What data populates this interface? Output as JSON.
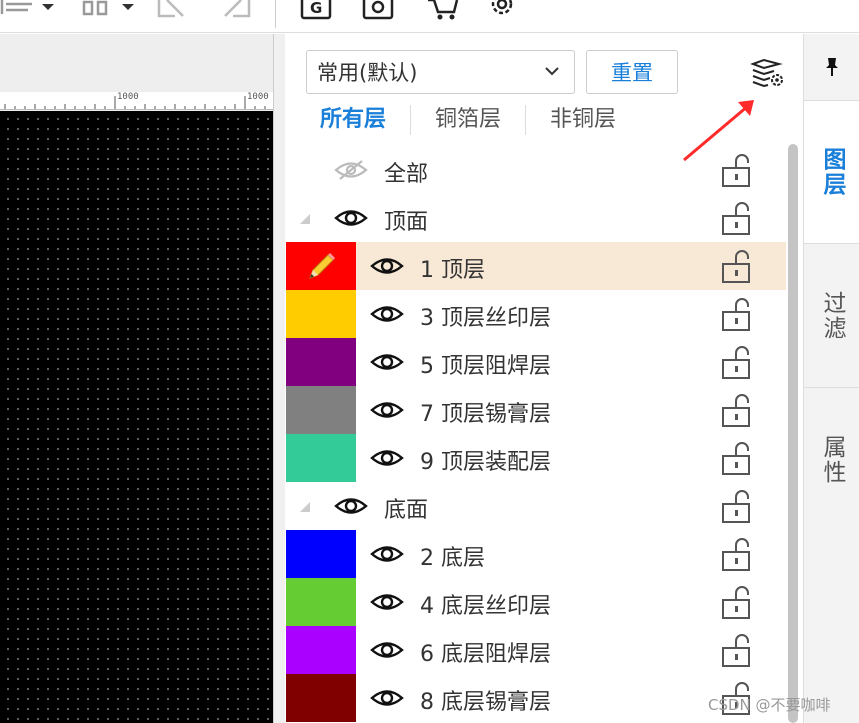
{
  "toolbar": {
    "icons": [
      "align-icon",
      "distribute-icon",
      "flip-h-icon",
      "flip-v-icon",
      "gerber-icon",
      "gear-box-icon",
      "cart-icon",
      "settings-icon"
    ],
    "gerber_letter": "G"
  },
  "ruler": {
    "labels": [
      "1000",
      "1000"
    ]
  },
  "panel": {
    "preset": {
      "value": "常用(默认)"
    },
    "reset_label": "重置",
    "filter_tabs": [
      {
        "label": "所有层",
        "active": true
      },
      {
        "label": "铜箔层",
        "active": false
      },
      {
        "label": "非铜层",
        "active": false
      }
    ],
    "rows": [
      {
        "kind": "all",
        "label": "全部",
        "visible": false
      },
      {
        "kind": "group",
        "label": "顶面",
        "visible": true
      },
      {
        "kind": "layer",
        "label": "1 顶层",
        "color": "#ff0000",
        "selected": true,
        "editing": true
      },
      {
        "kind": "layer",
        "label": "3 顶层丝印层",
        "color": "#ffcc00"
      },
      {
        "kind": "layer",
        "label": "5 顶层阻焊层",
        "color": "#800080"
      },
      {
        "kind": "layer",
        "label": "7 顶层锡膏层",
        "color": "#808080"
      },
      {
        "kind": "layer",
        "label": "9 顶层装配层",
        "color": "#33cc99"
      },
      {
        "kind": "group",
        "label": "底面",
        "visible": true
      },
      {
        "kind": "layer",
        "label": "2 底层",
        "color": "#0000ff"
      },
      {
        "kind": "layer",
        "label": "4 底层丝印层",
        "color": "#66cc33"
      },
      {
        "kind": "layer",
        "label": "6 底层阻焊层",
        "color": "#aa00ff"
      },
      {
        "kind": "layer",
        "label": "8 底层锡膏层",
        "color": "#800000"
      }
    ]
  },
  "side_tabs": [
    {
      "label": "图层",
      "active": true
    },
    {
      "label": "过滤",
      "active": false
    },
    {
      "label": "属性",
      "active": false
    }
  ],
  "watermark": "CSDN @不要咖啡",
  "colors": {
    "accent": "#1a7fd9",
    "selected_row": "#f8e8d6",
    "annotation_arrow": "#ff2a2a"
  }
}
